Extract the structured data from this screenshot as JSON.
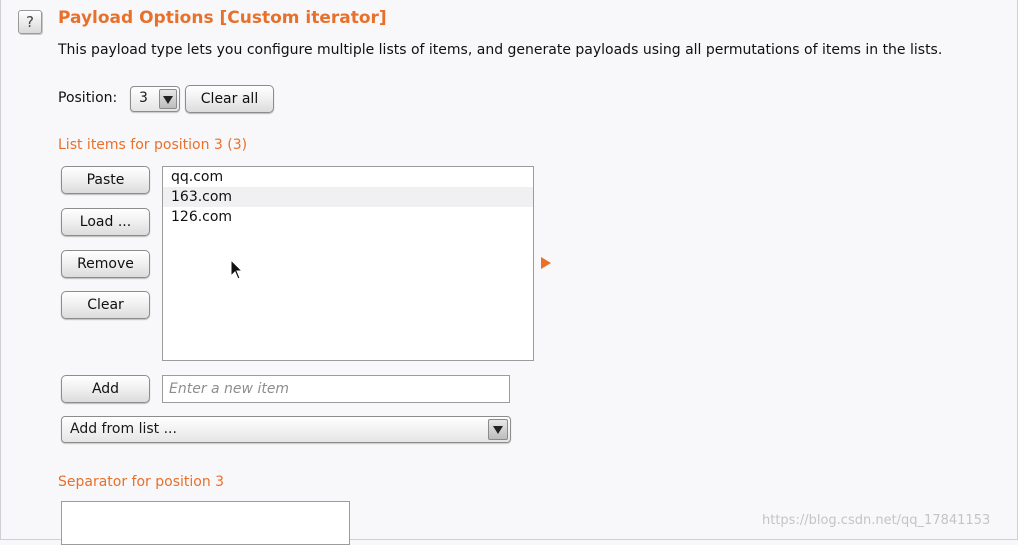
{
  "header": {
    "help_icon": "question-mark-icon",
    "title": "Payload Options [Custom iterator]",
    "description": "This payload type lets you configure multiple lists of items, and generate payloads using all permutations of items in the lists."
  },
  "position": {
    "label": "Position:",
    "selected": "3",
    "clear_all_label": "Clear all"
  },
  "list": {
    "heading": "List items for position 3 (3)",
    "items": [
      "qq.com",
      "163.com",
      "126.com"
    ],
    "buttons": {
      "paste": "Paste",
      "load": "Load ...",
      "remove": "Remove",
      "clear": "Clear",
      "add": "Add"
    },
    "new_item_placeholder": "Enter a new item",
    "add_from_list": "Add from list ..."
  },
  "separator": {
    "heading": "Separator for position 3",
    "value": ""
  },
  "watermark": "https://blog.csdn.net/qq_17841153",
  "colors": {
    "accent": "#e8702a",
    "background": "#f8f8fa"
  }
}
